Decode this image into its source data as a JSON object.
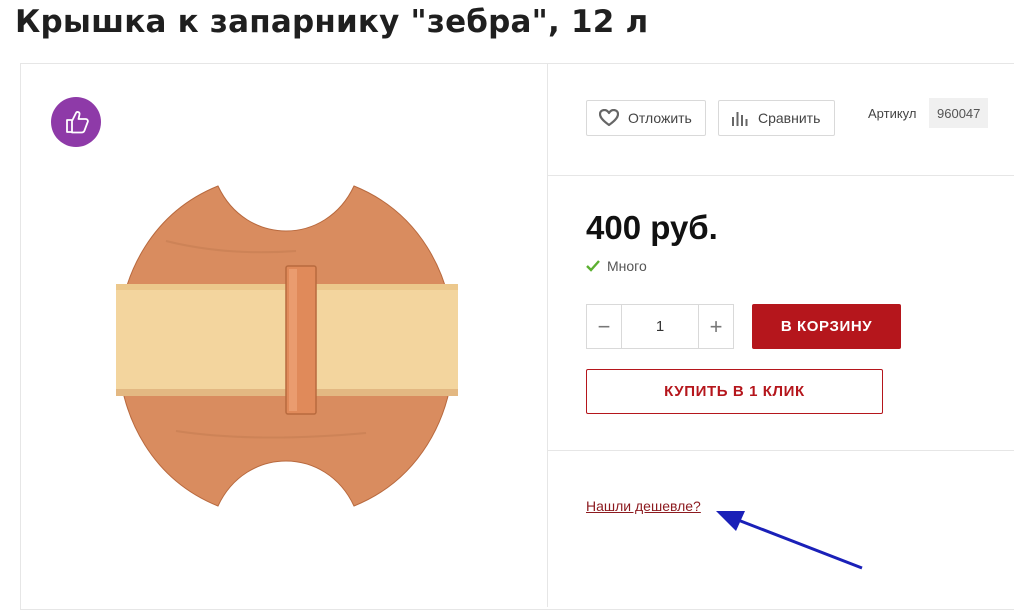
{
  "page": {
    "title": "Крышка к запарнику \"зебра\", 12 л"
  },
  "product_image": {
    "badge_icon": "thumbs-up-icon",
    "badge_color": "#8e3aa8",
    "image_subject": "round-wooden-lid"
  },
  "actions": {
    "save_label": "Отложить",
    "save_icon": "heart-icon",
    "compare_label": "Сравнить",
    "compare_icon": "bar-chart-icon",
    "article_label": "Артикул",
    "article_value": "960047"
  },
  "purchase": {
    "price": "400 руб.",
    "stock_icon": "checkmark-icon",
    "stock_text": "Много",
    "stock_color": "#5cb031",
    "quantity": "1",
    "minus_symbol": "−",
    "plus_symbol": "+",
    "cart_button": "В КОРЗИНУ",
    "one_click_button": "КУПИТЬ В 1 КЛИК",
    "accent_color": "#b5161c"
  },
  "extra": {
    "cheaper_link": "Нашли дешевле?",
    "annotation_arrow_color": "#1a20b8"
  }
}
